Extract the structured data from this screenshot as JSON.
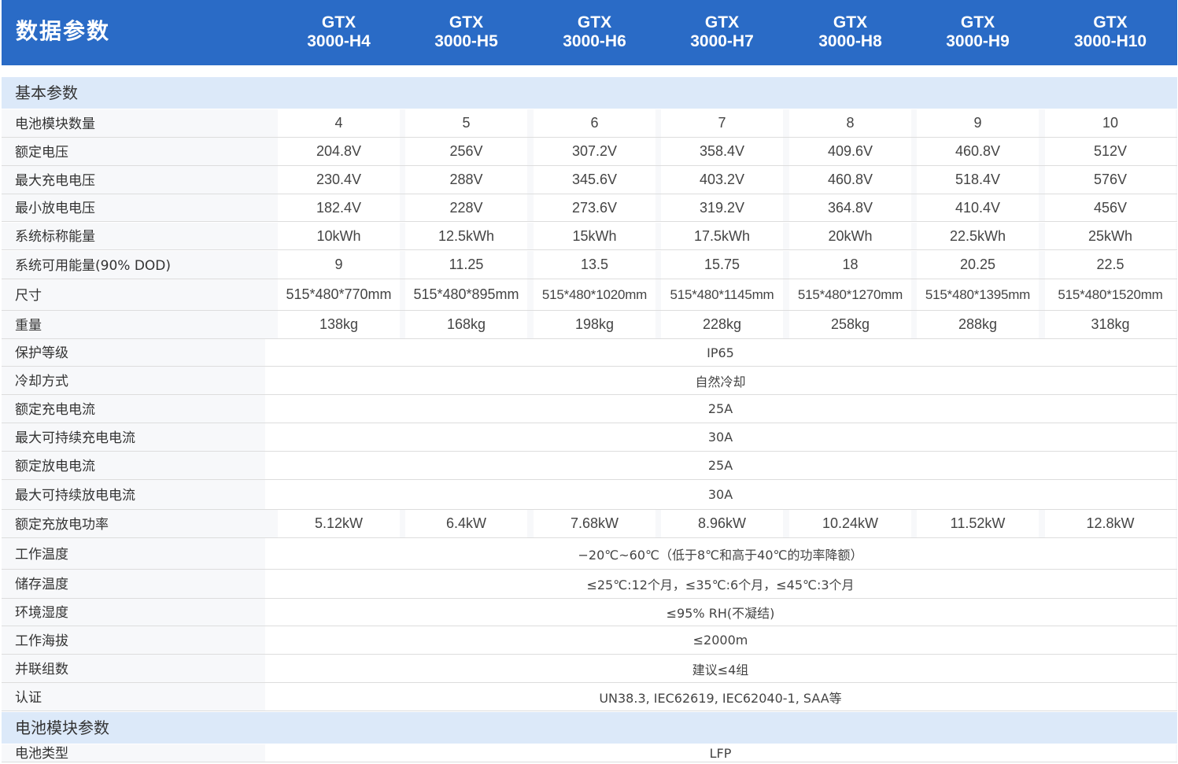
{
  "header": {
    "title": "数据参数",
    "models": [
      {
        "line1": "GTX",
        "line2": "3000-H4"
      },
      {
        "line1": "GTX",
        "line2": "3000-H5"
      },
      {
        "line1": "GTX",
        "line2": "3000-H6"
      },
      {
        "line1": "GTX",
        "line2": "3000-H7"
      },
      {
        "line1": "GTX",
        "line2": "3000-H8"
      },
      {
        "line1": "GTX",
        "line2": "3000-H9"
      },
      {
        "line1": "GTX",
        "line2": "3000-H10"
      }
    ]
  },
  "sections": {
    "basic": "基本参数",
    "module": "电池模块参数"
  },
  "rows": [
    {
      "label": "电池模块数量",
      "values": [
        "4",
        "5",
        "6",
        "7",
        "8",
        "9",
        "10"
      ]
    },
    {
      "label": "额定电压",
      "values": [
        "204.8V",
        "256V",
        "307.2V",
        "358.4V",
        "409.6V",
        "460.8V",
        "512V"
      ]
    },
    {
      "label": "最大充电电压",
      "values": [
        "230.4V",
        "288V",
        "345.6V",
        "403.2V",
        "460.8V",
        "518.4V",
        "576V"
      ]
    },
    {
      "label": "最小放电电压",
      "values": [
        "182.4V",
        "228V",
        "273.6V",
        "319.2V",
        "364.8V",
        "410.4V",
        "456V"
      ]
    },
    {
      "label": "系统标称能量",
      "values": [
        "10kWh",
        "12.5kWh",
        "15kWh",
        "17.5kWh",
        "20kWh",
        "22.5kWh",
        "25kWh"
      ]
    },
    {
      "label": "系统可用能量(90% DOD)",
      "values": [
        "9",
        "11.25",
        "13.5",
        "15.75",
        "18",
        "20.25",
        "22.5"
      ]
    },
    {
      "label": "尺寸",
      "values": [
        "515*480*770mm",
        "515*480*895mm",
        "515*480*1020mm",
        "515*480*1145mm",
        "515*480*1270mm",
        "515*480*1395mm",
        "515*480*1520mm"
      ]
    },
    {
      "label": "重量",
      "values": [
        "138kg",
        "168kg",
        "198kg",
        "228kg",
        "258kg",
        "288kg",
        "318kg"
      ]
    },
    {
      "label": "保护等级",
      "value": "IP65"
    },
    {
      "label": "冷却方式",
      "value": "自然冷却"
    },
    {
      "label": "额定充电电流",
      "value": "25A"
    },
    {
      "label": "最大可持续充电电流",
      "value": "30A"
    },
    {
      "label": "额定放电电流",
      "value": "25A"
    },
    {
      "label": "最大可持续放电电流",
      "value": "30A"
    },
    {
      "label": "额定充放电功率",
      "values": [
        "5.12kW",
        "6.4kW",
        "7.68kW",
        "8.96kW",
        "10.24kW",
        "11.52kW",
        "12.8kW"
      ]
    },
    {
      "label": "工作温度",
      "value": "−20℃~60℃（低于8℃和高于40℃的功率降额）"
    },
    {
      "label": "储存温度",
      "value": "≤25℃:12个月，≤35℃:6个月，≤45℃:3个月"
    },
    {
      "label": "环境湿度",
      "value": "≤95% RH(不凝结)"
    },
    {
      "label": "工作海拔",
      "value": "≤2000m"
    },
    {
      "label": "并联组数",
      "value": "建议≤4组"
    },
    {
      "label": "认证",
      "value": "UN38.3, IEC62619, IEC62040-1, SAA等"
    }
  ],
  "module_rows": [
    {
      "label": "电池类型",
      "value": "LFP"
    }
  ]
}
